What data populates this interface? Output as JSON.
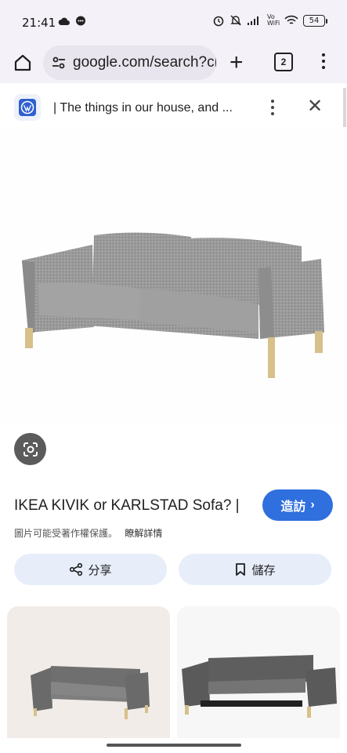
{
  "status": {
    "time": "21:41",
    "battery": "54",
    "vowifi": "Vo WiFi"
  },
  "browser": {
    "url": "google.com/search?cl",
    "tab_count": "2"
  },
  "source": {
    "title": "| The things in our house, and ..."
  },
  "result": {
    "caption": "IKEA KIVIK or KARLSTAD Sofa? |",
    "visit_label": "造訪",
    "copyright_notice": "圖片可能受著作權保護。",
    "learn_more": "瞭解詳情",
    "share_label": "分享",
    "save_label": "儲存"
  },
  "colors": {
    "accent": "#2f6fde",
    "chrome_bg": "#f4f1f8",
    "pill_bg": "#e7eefa"
  }
}
